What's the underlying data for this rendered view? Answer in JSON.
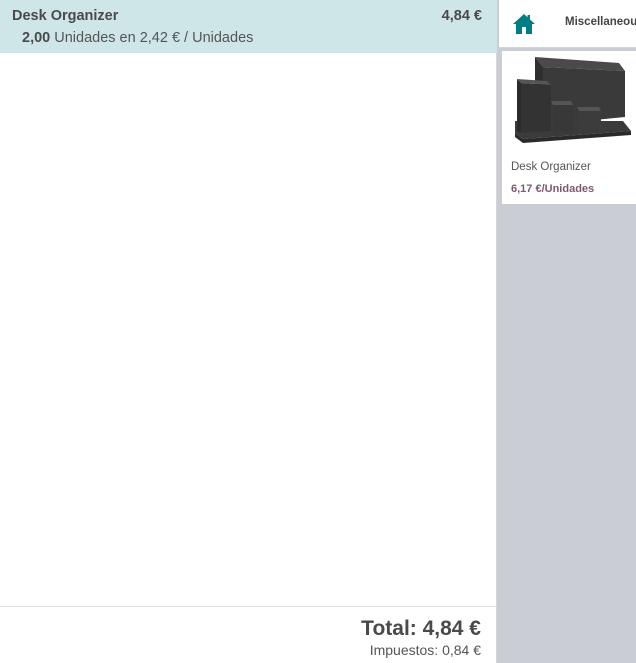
{
  "order": {
    "lines": [
      {
        "name": "Desk Organizer",
        "price": "4,84 €",
        "quantity": "2,00",
        "unit_info": "Unidades en 2,42 € / Unidades"
      }
    ],
    "total_label": "Total: 4,84 €",
    "taxes_label": "Impuestos: 0,84 €"
  },
  "products": {
    "breadcrumb": {
      "home_icon": "home-icon",
      "category": "Miscellaneous"
    },
    "items": [
      {
        "name": "Desk Organizer",
        "price": "6,17 €/Unidades"
      }
    ]
  },
  "colors": {
    "selected_line_bg": "#cfe6e8",
    "products_pane_bg": "#cacdd4",
    "home_icon": "#017e84",
    "price_accent": "#7d5a6e"
  }
}
